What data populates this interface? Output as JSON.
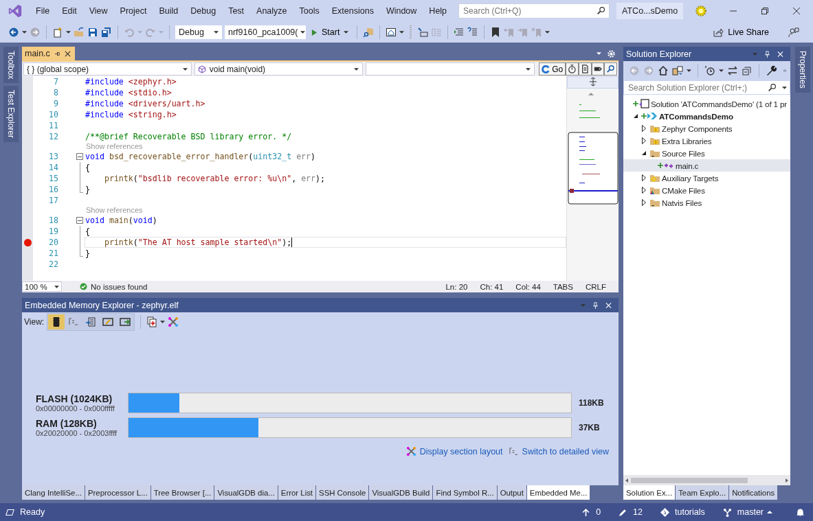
{
  "window": {
    "badge": "ATCo...sDemo"
  },
  "menu": [
    "File",
    "Edit",
    "View",
    "Project",
    "Build",
    "Debug",
    "Test",
    "Analyze",
    "Tools",
    "Extensions",
    "Window",
    "Help"
  ],
  "search": {
    "placeholder": "Search (Ctrl+Q)"
  },
  "toolbar": {
    "configuration": "Debug",
    "target": "nrf9160_pca1009(",
    "start": "Start",
    "live_share": "Live Share"
  },
  "side_tabs_left": [
    "Toolbox",
    "Test Explorer"
  ],
  "side_tabs_right": [
    "Properties"
  ],
  "editor": {
    "tabs": [
      {
        "label": "main.c",
        "selected": true
      }
    ],
    "scope": "{ } (global scope)",
    "function": "void main(void)",
    "go": "Go",
    "lines": [
      {
        "kind": "line",
        "number": "7",
        "breakpoint": false,
        "current": false,
        "collapsible": false,
        "guide": false,
        "tokens": [
          {
            "kind": "keyword",
            "text": "#include"
          },
          {
            "kind": "string",
            "text": " <zephyr.h>"
          }
        ]
      },
      {
        "kind": "line",
        "number": "8",
        "breakpoint": false,
        "current": false,
        "collapsible": false,
        "guide": false,
        "tokens": [
          {
            "kind": "keyword",
            "text": "#include"
          },
          {
            "kind": "string",
            "text": " <stdio.h>"
          }
        ]
      },
      {
        "kind": "line",
        "number": "9",
        "breakpoint": false,
        "current": false,
        "collapsible": false,
        "guide": false,
        "tokens": [
          {
            "kind": "keyword",
            "text": "#include"
          },
          {
            "kind": "string",
            "text": " <drivers/uart.h>"
          }
        ]
      },
      {
        "kind": "line",
        "number": "10",
        "breakpoint": false,
        "current": false,
        "collapsible": false,
        "guide": false,
        "tokens": [
          {
            "kind": "keyword",
            "text": "#include"
          },
          {
            "kind": "string",
            "text": " <string.h>"
          }
        ]
      },
      {
        "kind": "line",
        "number": "11",
        "breakpoint": false,
        "current": false,
        "collapsible": false,
        "guide": false
      },
      {
        "kind": "line",
        "number": "12",
        "breakpoint": false,
        "current": false,
        "collapsible": false,
        "guide": false,
        "tokens": [
          {
            "kind": "comment",
            "text": "/**@brief Recoverable BSD library error. */"
          }
        ]
      },
      {
        "kind": "codelens",
        "text": "Show references"
      },
      {
        "kind": "line",
        "number": "13",
        "breakpoint": false,
        "current": false,
        "collapsible": true,
        "guide": false,
        "tokens": [
          {
            "kind": "keyword",
            "text": "void"
          },
          {
            "kind": "function",
            "text": " bsd_recoverable_error_handler"
          },
          {
            "kind": "plain",
            "text": "("
          },
          {
            "kind": "type",
            "text": "uint32_t"
          },
          {
            "kind": "param",
            "text": " err"
          },
          {
            "kind": "plain",
            "text": ")"
          }
        ]
      },
      {
        "kind": "line",
        "number": "14",
        "breakpoint": false,
        "current": false,
        "collapsible": false,
        "guide": true,
        "tokens": [
          {
            "kind": "plain",
            "text": "{"
          }
        ]
      },
      {
        "kind": "line",
        "number": "15",
        "breakpoint": false,
        "current": false,
        "collapsible": false,
        "guide": true,
        "tokens": [
          {
            "kind": "function",
            "text": "    printk"
          },
          {
            "kind": "plain",
            "text": "("
          },
          {
            "kind": "string",
            "text": "\"bsdlib recoverable error: %u\\n\""
          },
          {
            "kind": "plain",
            "text": ", "
          },
          {
            "kind": "param",
            "text": "err"
          },
          {
            "kind": "plain",
            "text": ");"
          }
        ]
      },
      {
        "kind": "line",
        "number": "16",
        "breakpoint": false,
        "current": false,
        "collapsible": false,
        "guide": true,
        "tokens": [
          {
            "kind": "plain",
            "text": "}"
          }
        ]
      },
      {
        "kind": "line",
        "number": "17",
        "breakpoint": false,
        "current": false,
        "collapsible": false,
        "guide": false
      },
      {
        "kind": "codelens",
        "text": "Show references"
      },
      {
        "kind": "line",
        "number": "18",
        "breakpoint": false,
        "current": false,
        "collapsible": true,
        "guide": false,
        "tokens": [
          {
            "kind": "keyword",
            "text": "void"
          },
          {
            "kind": "function",
            "text": " main"
          },
          {
            "kind": "plain",
            "text": "("
          },
          {
            "kind": "keyword",
            "text": "void"
          },
          {
            "kind": "plain",
            "text": ")"
          }
        ]
      },
      {
        "kind": "line",
        "number": "19",
        "breakpoint": false,
        "current": false,
        "collapsible": false,
        "guide": true,
        "tokens": [
          {
            "kind": "plain",
            "text": "{"
          }
        ]
      },
      {
        "kind": "line",
        "number": "20",
        "breakpoint": true,
        "current": true,
        "collapsible": false,
        "guide": true,
        "tokens": [
          {
            "kind": "function",
            "text": "    printk"
          },
          {
            "kind": "plain",
            "text": "("
          },
          {
            "kind": "string",
            "text": "\"The AT host sample started\\n\""
          },
          {
            "kind": "plain",
            "text": ");"
          }
        ]
      },
      {
        "kind": "line",
        "number": "21",
        "breakpoint": false,
        "current": false,
        "collapsible": false,
        "guide": true,
        "tokens": [
          {
            "kind": "plain",
            "text": "}"
          }
        ]
      },
      {
        "kind": "line",
        "number": "22",
        "breakpoint": false,
        "current": false,
        "collapsible": false,
        "guide": false
      }
    ],
    "status": {
      "zoom": "100 %",
      "issues": "No issues found",
      "ln": "Ln: 20",
      "ch": "Ch: 41",
      "col": "Col: 44",
      "indent": "TABS",
      "eol": "CRLF"
    }
  },
  "memory_explorer": {
    "title": "Embedded Memory Explorer - zephyr.elf",
    "view_label": "View:",
    "view_modes": [
      {
        "selected": true
      },
      {
        "selected": false
      },
      {
        "selected": false
      },
      {
        "selected": false
      },
      {
        "selected": false
      }
    ],
    "regions": [
      {
        "name": "FLASH (1024KB)",
        "range": "0x00000000 - 0x000fffff",
        "level": 0.115,
        "used": "118KB"
      },
      {
        "name": "RAM (128KB)",
        "range": "0x20020000 - 0x2003ffff",
        "level": 0.294,
        "used": "37KB"
      }
    ],
    "links": [
      "Display section layout",
      "Switch to detailed view"
    ]
  },
  "bottom_tabs": [
    {
      "label": "Clang IntelliSe...",
      "selected": false
    },
    {
      "label": "Preprocessor L...",
      "selected": false
    },
    {
      "label": "Tree Browser [...",
      "selected": false
    },
    {
      "label": "VisualGDB dia...",
      "selected": false
    },
    {
      "label": "Error List",
      "selected": false
    },
    {
      "label": "SSH Console",
      "selected": false
    },
    {
      "label": "VisualGDB Build",
      "selected": false
    },
    {
      "label": "Find Symbol R...",
      "selected": false
    },
    {
      "label": "Output",
      "selected": false
    },
    {
      "label": "Embedded Me...",
      "selected": true
    }
  ],
  "solution_explorer": {
    "title": "Solution Explorer",
    "search": {
      "placeholder": "Search Solution Explorer (Ctrl+;)"
    },
    "tree": [
      {
        "kind": "solution",
        "label": "Solution 'ATCommandsDemo' (1 of 1 pr",
        "selected": false,
        "children": [
          {
            "kind": "project",
            "label": "ATCommandsDemo",
            "selected": false,
            "expanded": true,
            "children": [
              {
                "kind": "package",
                "label": "Zephyr Components",
                "selected": false,
                "expanded": false
              },
              {
                "kind": "package",
                "label": "Extra Libraries",
                "selected": false,
                "expanded": false
              },
              {
                "kind": "folder",
                "label": "Source Files",
                "selected": false,
                "expanded": true,
                "children": [
                  {
                    "kind": "file",
                    "label": "main.c",
                    "selected": true
                  }
                ]
              },
              {
                "kind": "targets",
                "label": "Auxiliary Targets",
                "selected": false,
                "expanded": false
              },
              {
                "kind": "cmake",
                "label": "CMake Files",
                "selected": false,
                "expanded": false
              },
              {
                "kind": "folder",
                "label": "Natvis Files",
                "selected": false,
                "expanded": false
              }
            ]
          }
        ]
      }
    ],
    "tabs": [
      {
        "label": "Solution Ex...",
        "selected": true
      },
      {
        "label": "Team Explo...",
        "selected": false
      },
      {
        "label": "Notifications",
        "selected": false
      }
    ]
  },
  "status_bar": {
    "state": "Ready",
    "pending": "0",
    "changes": "12",
    "repository": "tutorials",
    "branch": "master"
  }
}
